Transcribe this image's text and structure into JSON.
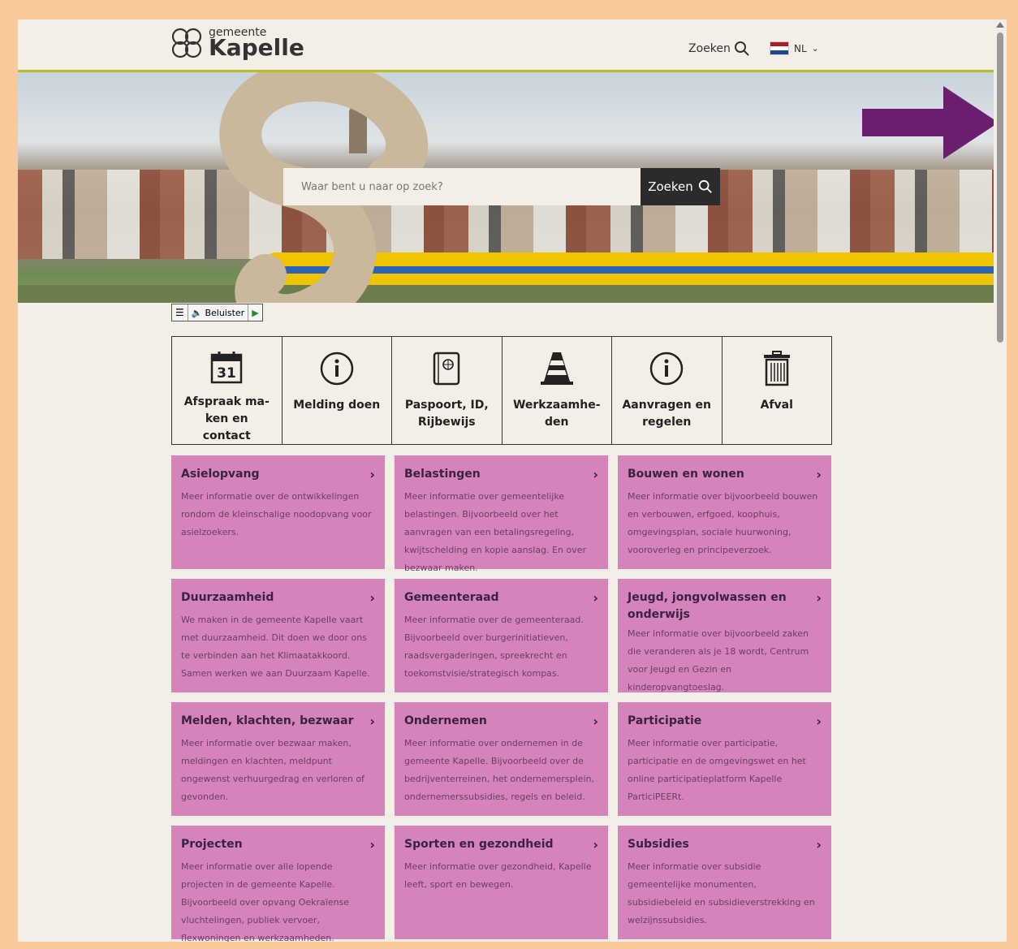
{
  "header": {
    "logo_small": "gemeente",
    "logo_big": "Kapelle",
    "search_label": "Zoeken",
    "language": "NL"
  },
  "hero": {
    "search_placeholder": "Waar bent u naar op zoek?",
    "search_button": "Zoeken"
  },
  "listen_bar": {
    "label": "Beluister"
  },
  "tiles": [
    {
      "label": "Afspraak ma-ken en contact",
      "icon": "calendar-icon",
      "day": "31"
    },
    {
      "label": "Melding doen",
      "icon": "info-icon"
    },
    {
      "label": "Paspoort, ID, Rijbewijs",
      "icon": "passport-icon"
    },
    {
      "label": "Werkzaamhe-den",
      "icon": "traffic-cone-icon"
    },
    {
      "label": "Aanvragen en regelen",
      "icon": "info-icon"
    },
    {
      "label": "Afval",
      "icon": "trash-icon"
    }
  ],
  "cards": [
    {
      "title": "Asielopvang",
      "text": "Meer informatie over de ontwikkelingen rondom de kleinschalige noodopvang voor asielzoekers."
    },
    {
      "title": "Belastingen",
      "text": "Meer informatie over gemeentelijke belastingen. Bijvoorbeeld over het aanvragen van een betalingsregeling, kwijtschelding en kopie aanslag. En over bezwaar maken."
    },
    {
      "title": "Bouwen en wonen",
      "text": "Meer informatie over bijvoorbeeld bouwen en verbouwen, erfgoed, koophuis, omgevingsplan, sociale huurwoning, vooroverleg en principeverzoek."
    },
    {
      "title": "Duurzaamheid",
      "text": "We maken in de gemeente Kapelle vaart met duurzaamheid. Dit doen we door ons te verbinden aan het Klimaatakkoord. Samen werken we aan Duurzaam Kapelle."
    },
    {
      "title": "Gemeenteraad",
      "text": "Meer informatie over de gemeenteraad. Bijvoorbeeld over burgerinitiatieven, raadsvergaderingen, spreekrecht en toekomstvisie/strategisch kompas."
    },
    {
      "title": "Jeugd, jongvolwassen en onderwijs",
      "text": "Meer informatie over bijvoorbeeld zaken die veranderen als je 18 wordt, Centrum voor Jeugd en Gezin en kinderopvangtoeslag."
    },
    {
      "title": "Melden, klachten, bezwaar",
      "text": "Meer informatie over bezwaar maken, meldingen en klachten, meldpunt ongewenst verhuurgedrag en verloren of gevonden."
    },
    {
      "title": "Ondernemen",
      "text": "Meer informatie over ondernemen in de gemeente Kapelle. Bijvoorbeeld over de bedrijventerreinen, het ondernemersplein, ondernemerssubsidies, regels en beleid."
    },
    {
      "title": "Participatie",
      "text": "Meer informatie over participatie, participatie en de omgevingswet en het online participatieplatform Kapelle ParticiPEERt."
    },
    {
      "title": "Projecten",
      "text": "Meer informatie over alle lopende projecten in de gemeente Kapelle. Bijvoorbeeld over opvang Oekraïense vluchtelingen, publiek vervoer, flexwoningen en werkzaamheden."
    },
    {
      "title": "Sporten en gezondheid",
      "text": "Meer informatie over gezondheid, Kapelle leeft, sport en bewegen."
    },
    {
      "title": "Subsidies",
      "text": "Meer informatie over subsidie gemeentelijke monumenten, subsidiebeleid en subsidieverstrekking en welzijnssubsidies."
    }
  ],
  "colors": {
    "card_bg": "#d483bb",
    "accent_line": "#b8bd2a",
    "arrow": "#6a1f6e",
    "page_bg": "#f3efe7",
    "outer_frame": "#f8c99b"
  }
}
